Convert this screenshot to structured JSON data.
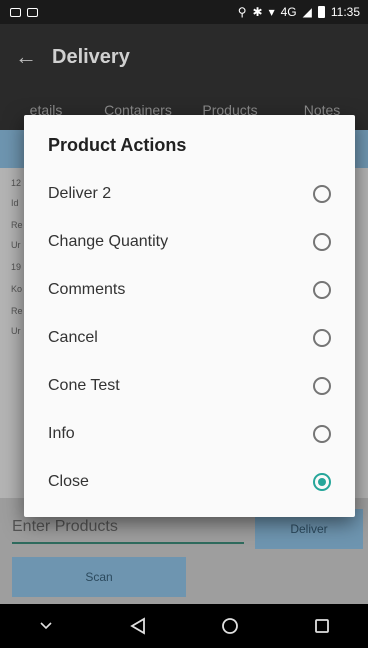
{
  "status_bar": {
    "time": "11:35",
    "network": "4G"
  },
  "app_bar": {
    "title": "Delivery"
  },
  "tabs": [
    {
      "label": "etails"
    },
    {
      "label": "Containers"
    },
    {
      "label": "Products"
    },
    {
      "label": "Notes"
    }
  ],
  "background_rows": [
    "12",
    "Id",
    "Re",
    "Ur",
    "19",
    "Ko",
    "Re",
    "Ur"
  ],
  "bottom": {
    "input_placeholder": "Enter Products",
    "deliver_label": "Deliver",
    "scan_label": "Scan"
  },
  "dialog": {
    "title": "Product Actions",
    "options": [
      {
        "label": "Deliver 2",
        "checked": false
      },
      {
        "label": "Change Quantity",
        "checked": false
      },
      {
        "label": "Comments",
        "checked": false
      },
      {
        "label": "Cancel",
        "checked": false
      },
      {
        "label": "Cone Test",
        "checked": false
      },
      {
        "label": "Info",
        "checked": false
      },
      {
        "label": "Close",
        "checked": true
      }
    ]
  },
  "colors": {
    "accent": "#26a69a",
    "button": "#6e95b0",
    "app_bar": "#2a2a2a"
  }
}
